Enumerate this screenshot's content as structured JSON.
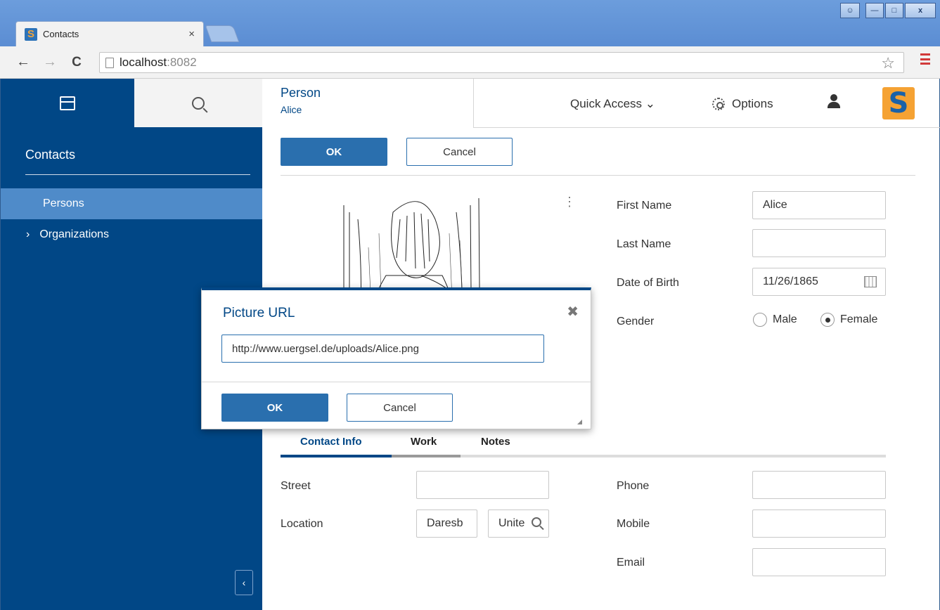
{
  "browser": {
    "tab_title": "Contacts",
    "tab_close": "×",
    "url_host": "localhost",
    "url_port": ":8082",
    "back": "←",
    "forward": "→",
    "reload": "C",
    "star": "☆"
  },
  "sidebar": {
    "title": "Contacts",
    "items": [
      {
        "label": "Persons",
        "selected": true
      },
      {
        "label": "Organizations",
        "expander": "›"
      }
    ],
    "collapse": "‹"
  },
  "header": {
    "view_title": "Person",
    "view_subtitle": "Alice",
    "quick_access": "Quick Access ⌄",
    "options": "Options",
    "logo_letter": "S"
  },
  "form": {
    "ok_label": "OK",
    "cancel_label": "Cancel",
    "menu_dots": "⋮",
    "fields": {
      "first_name_label": "First Name",
      "first_name_value": "Alice",
      "last_name_label": "Last Name",
      "last_name_value": "",
      "dob_label": "Date of Birth",
      "dob_value": "11/26/1865",
      "gender_label": "Gender",
      "gender_male": "Male",
      "gender_female": "Female",
      "gender_selected": "Female"
    },
    "tabs": [
      "Contact Info",
      "Work",
      "Notes"
    ],
    "contact": {
      "street_label": "Street",
      "street_value": "",
      "location_label": "Location",
      "city_value": "Daresb",
      "country_value": "Unite",
      "phone_label": "Phone",
      "phone_value": "",
      "mobile_label": "Mobile",
      "mobile_value": "",
      "email_label": "Email",
      "email_value": ""
    }
  },
  "dialog": {
    "title": "Picture URL",
    "close": "✖",
    "url_value": "http://www.uergsel.de/uploads/Alice.png",
    "ok_label": "OK",
    "cancel_label": "Cancel"
  },
  "colors": {
    "sidebar": "#014786",
    "accent": "#2a6fae",
    "selected_item": "#4f8bc9",
    "logo_bg": "#f5a233"
  }
}
